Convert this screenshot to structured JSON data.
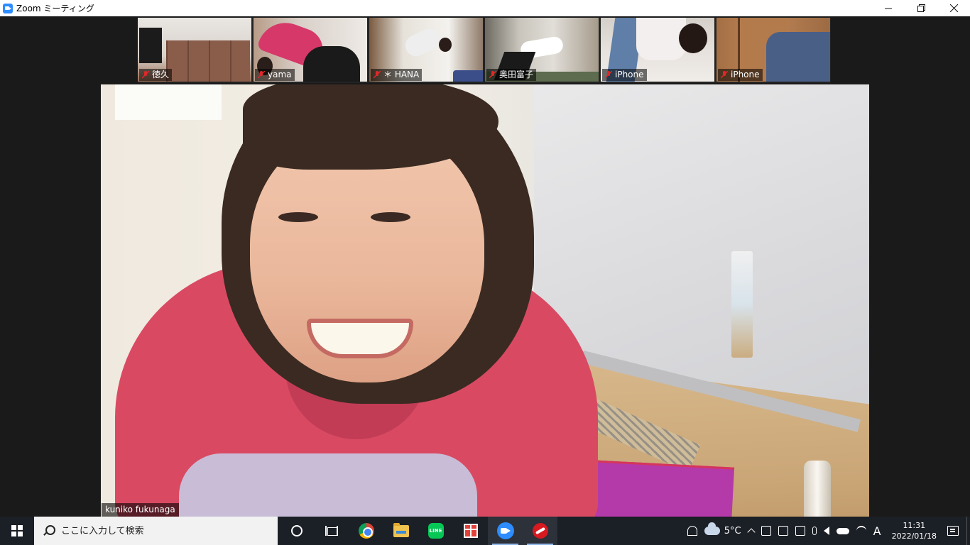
{
  "window": {
    "title": "Zoom ミーティング",
    "app_icon": "zoom-app-icon"
  },
  "window_controls": {
    "minimize": "minimize-icon",
    "restore": "restore-icon",
    "close": "close-icon"
  },
  "participants": [
    {
      "name": "徳久",
      "muted": true
    },
    {
      "name": "yama",
      "muted": true
    },
    {
      "name": "＊ HANA",
      "muted": true
    },
    {
      "name": "奥田富子",
      "muted": true
    },
    {
      "name": "iPhone",
      "muted": true
    },
    {
      "name": "iPhone",
      "muted": true
    }
  ],
  "active_speaker": {
    "name": "kuniko fukunaga"
  },
  "taskbar": {
    "search_placeholder": "ここに入力して検索",
    "apps": [
      {
        "name": "cortana-icon"
      },
      {
        "name": "task-view-icon"
      },
      {
        "name": "chrome-icon"
      },
      {
        "name": "file-explorer-icon"
      },
      {
        "name": "line-icon",
        "label": "LINE"
      },
      {
        "name": "gift-icon"
      },
      {
        "name": "zoom-icon",
        "active": true
      },
      {
        "name": "trend-micro-icon",
        "active": true
      }
    ],
    "weather": {
      "temp": "5°C"
    },
    "ime": "A",
    "clock": {
      "time": "11:31",
      "date": "2022/01/18"
    }
  },
  "colors": {
    "accent": "#2d8cff",
    "taskbar": "#1b1f26",
    "meeting_bg": "#1a1a1a",
    "mute_red": "#e02828"
  }
}
